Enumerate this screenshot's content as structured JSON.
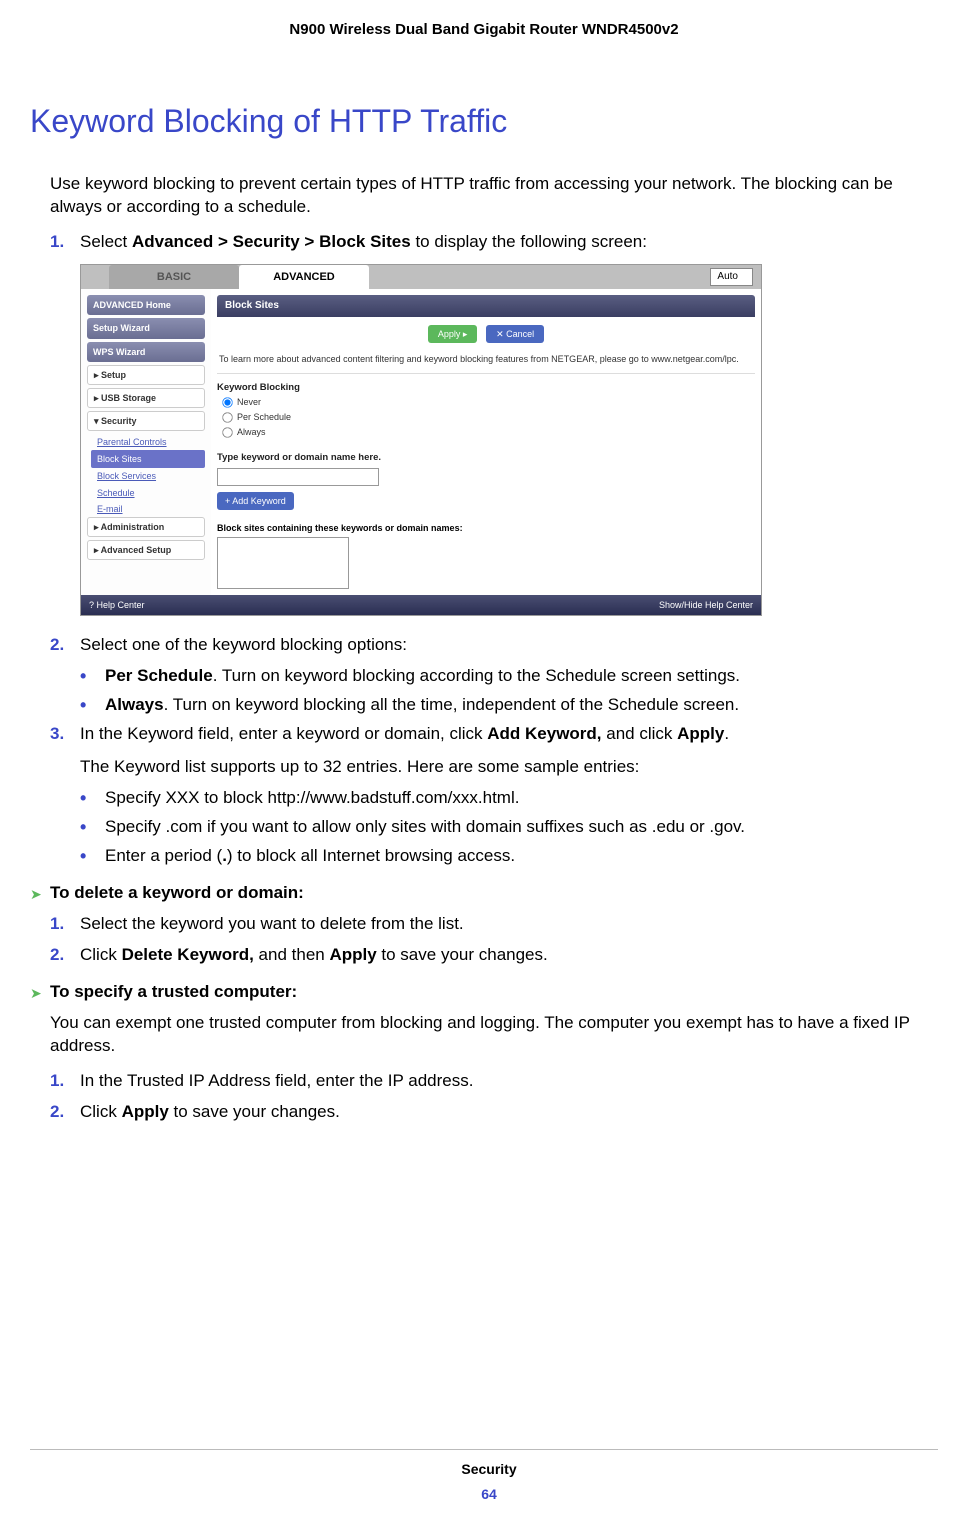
{
  "header": {
    "product": "N900 Wireless Dual Band Gigabit Router WNDR4500v2"
  },
  "title": "Keyword Blocking of HTTP Traffic",
  "intro": "Use keyword blocking to prevent certain types of HTTP traffic from accessing your network. The blocking can be always or according to a schedule.",
  "steps_primary": {
    "s1_num": "1.",
    "s1_pre": "Select ",
    "s1_bold": "Advanced > Security > Block Sites",
    "s1_post": " to display the following screen:",
    "s2_num": "2.",
    "s2_text": "Select one of the keyword blocking options:",
    "s2_b1_bold": "Per Schedule",
    "s2_b1_text": ". Turn on keyword blocking according to the Schedule screen settings.",
    "s2_b2_bold": "Always",
    "s2_b2_text": ". Turn on keyword blocking all the time, independent of the Schedule screen.",
    "s3_num": "3.",
    "s3_pre": "In the Keyword field, enter a keyword or domain, click ",
    "s3_b1": "Add Keyword,",
    "s3_mid": " and click ",
    "s3_b2": "Apply",
    "s3_post": ".",
    "s3_note": "The Keyword list supports up to 32 entries. Here are some sample entries:",
    "s3_bul1": "Specify XXX to block http://www.badstuff.com/xxx.html.",
    "s3_bul2": "Specify .com if you want to allow only sites with domain suffixes such as .edu or .gov.",
    "s3_bul3_pre": "Enter a period (",
    "s3_bul3_bold": ".",
    "s3_bul3_post": ") to block all Internet browsing access."
  },
  "delete_proc": {
    "title": "To delete a keyword or domain:",
    "s1_num": "1.",
    "s1": "Select the keyword you want to delete from the list.",
    "s2_num": "2.",
    "s2_pre": "Click ",
    "s2_b1": "Delete Keyword,",
    "s2_mid": " and then ",
    "s2_b2": "Apply",
    "s2_post": " to save your changes."
  },
  "trusted_proc": {
    "title": "To specify a trusted computer:",
    "intro": "You can exempt one trusted computer from blocking and logging. The computer you exempt has to have a fixed IP address.",
    "s1_num": "1.",
    "s1": "In the Trusted IP Address field, enter the IP address.",
    "s2_num": "2.",
    "s2_pre": "Click ",
    "s2_b1": "Apply",
    "s2_post": " to save your changes."
  },
  "screenshot": {
    "tab_basic": "BASIC",
    "tab_adv": "ADVANCED",
    "auto": "Auto",
    "side": {
      "home": "ADVANCED Home",
      "wizard": "Setup Wizard",
      "wps": "WPS Wizard",
      "setup": "▸ Setup",
      "usb": "▸ USB Storage",
      "security": "▾ Security",
      "parental": "Parental Controls",
      "block_sites": "Block Sites",
      "block_services": "Block Services",
      "schedule": "Schedule",
      "email": "E-mail",
      "admin": "▸ Administration",
      "adv_setup": "▸ Advanced Setup"
    },
    "panel_title": "Block Sites",
    "apply": "Apply ▸",
    "cancel": "✕ Cancel",
    "info": "To learn more about advanced content filtering and keyword blocking features from NETGEAR, please go to www.netgear.com/lpc.",
    "kw_label": "Keyword Blocking",
    "opt_never": "Never",
    "opt_per": "Per Schedule",
    "opt_always": "Always",
    "type_label": "Type keyword or domain name here.",
    "add_keyword": "+ Add Keyword",
    "block_label": "Block sites containing these keywords or domain names:",
    "help_center": "? Help Center",
    "show_hide": "Show/Hide Help Center"
  },
  "footer": {
    "section": "Security",
    "page": "64"
  }
}
